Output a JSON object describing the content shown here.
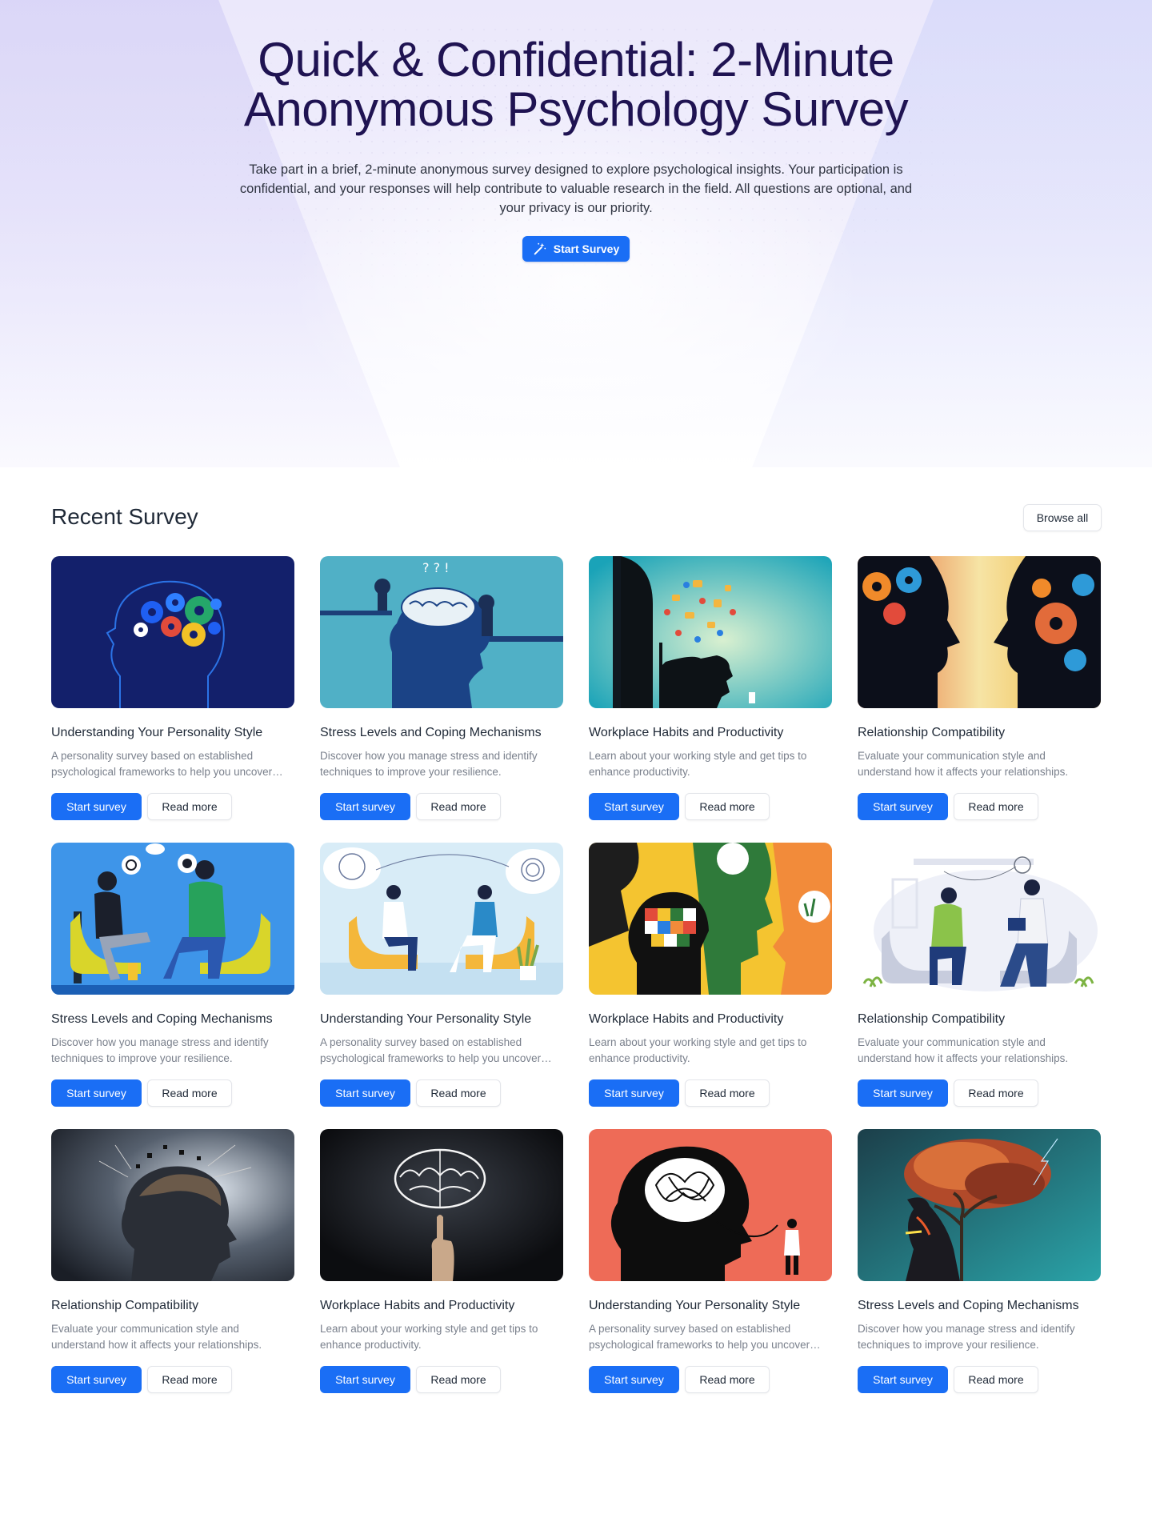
{
  "hero": {
    "title": "Quick & Confidential: 2-Minute Anonymous Psychology Survey",
    "subtitle": "Take part in a brief, 2-minute anonymous survey designed to explore psychological insights. Your participation is confidential, and your responses will help contribute to valuable research in the field. All questions are optional, and your privacy is our priority.",
    "cta_label": "Start Survey",
    "cta_icon": "magic-wand-icon"
  },
  "recent": {
    "title": "Recent Survey",
    "browse_label": "Browse all",
    "primary_label": "Start survey",
    "secondary_label": "Read more",
    "cards": [
      {
        "title": "Understanding Your Personality Style",
        "description": "A personality survey based on established psychological frameworks to help you uncover your unique traits and tendencies.",
        "image": "gears-head-illustration"
      },
      {
        "title": "Stress Levels and Coping Mechanisms",
        "description": "Discover how you manage stress and identify techniques to improve your resilience.",
        "image": "brain-explorers-illustration"
      },
      {
        "title": "Workplace Habits and Productivity",
        "description": "Learn about your working style and get tips to enhance productivity.",
        "image": "open-head-icons-illustration"
      },
      {
        "title": "Relationship Compatibility",
        "description": "Evaluate your communication style and understand how it affects your relationships.",
        "image": "two-faces-gears-illustration"
      },
      {
        "title": "Stress Levels and Coping Mechanisms",
        "description": "Discover how you manage stress and identify techniques to improve your resilience.",
        "image": "therapy-chat-illustration"
      },
      {
        "title": "Understanding Your Personality Style",
        "description": "A personality survey based on established psychological frameworks to help you uncover your unique traits and tendencies.",
        "image": "counseling-session-illustration"
      },
      {
        "title": "Workplace Habits and Productivity",
        "description": "Learn about your working style and get tips to enhance productivity.",
        "image": "puzzle-heads-illustration"
      },
      {
        "title": "Relationship Compatibility",
        "description": "Evaluate your communication style and understand how it affects your relationships.",
        "image": "therapist-notes-illustration"
      },
      {
        "title": "Relationship Compatibility",
        "description": "Evaluate your communication style and understand how it affects your relationships.",
        "image": "storm-head-illustration"
      },
      {
        "title": "Workplace Habits and Productivity",
        "description": "Learn about your working style and get tips to enhance productivity.",
        "image": "glowing-brain-illustration"
      },
      {
        "title": "Understanding Your Personality Style",
        "description": "A personality survey based on established psychological frameworks to help you uncover your unique traits and tendencies.",
        "image": "tangled-mind-illustration"
      },
      {
        "title": "Stress Levels and Coping Mechanisms",
        "description": "Discover how you manage stress and identify techniques to improve your resilience.",
        "image": "tree-head-illustration"
      }
    ]
  },
  "colors": {
    "primary": "#1a6ef5",
    "hero_title": "#1f1352"
  }
}
